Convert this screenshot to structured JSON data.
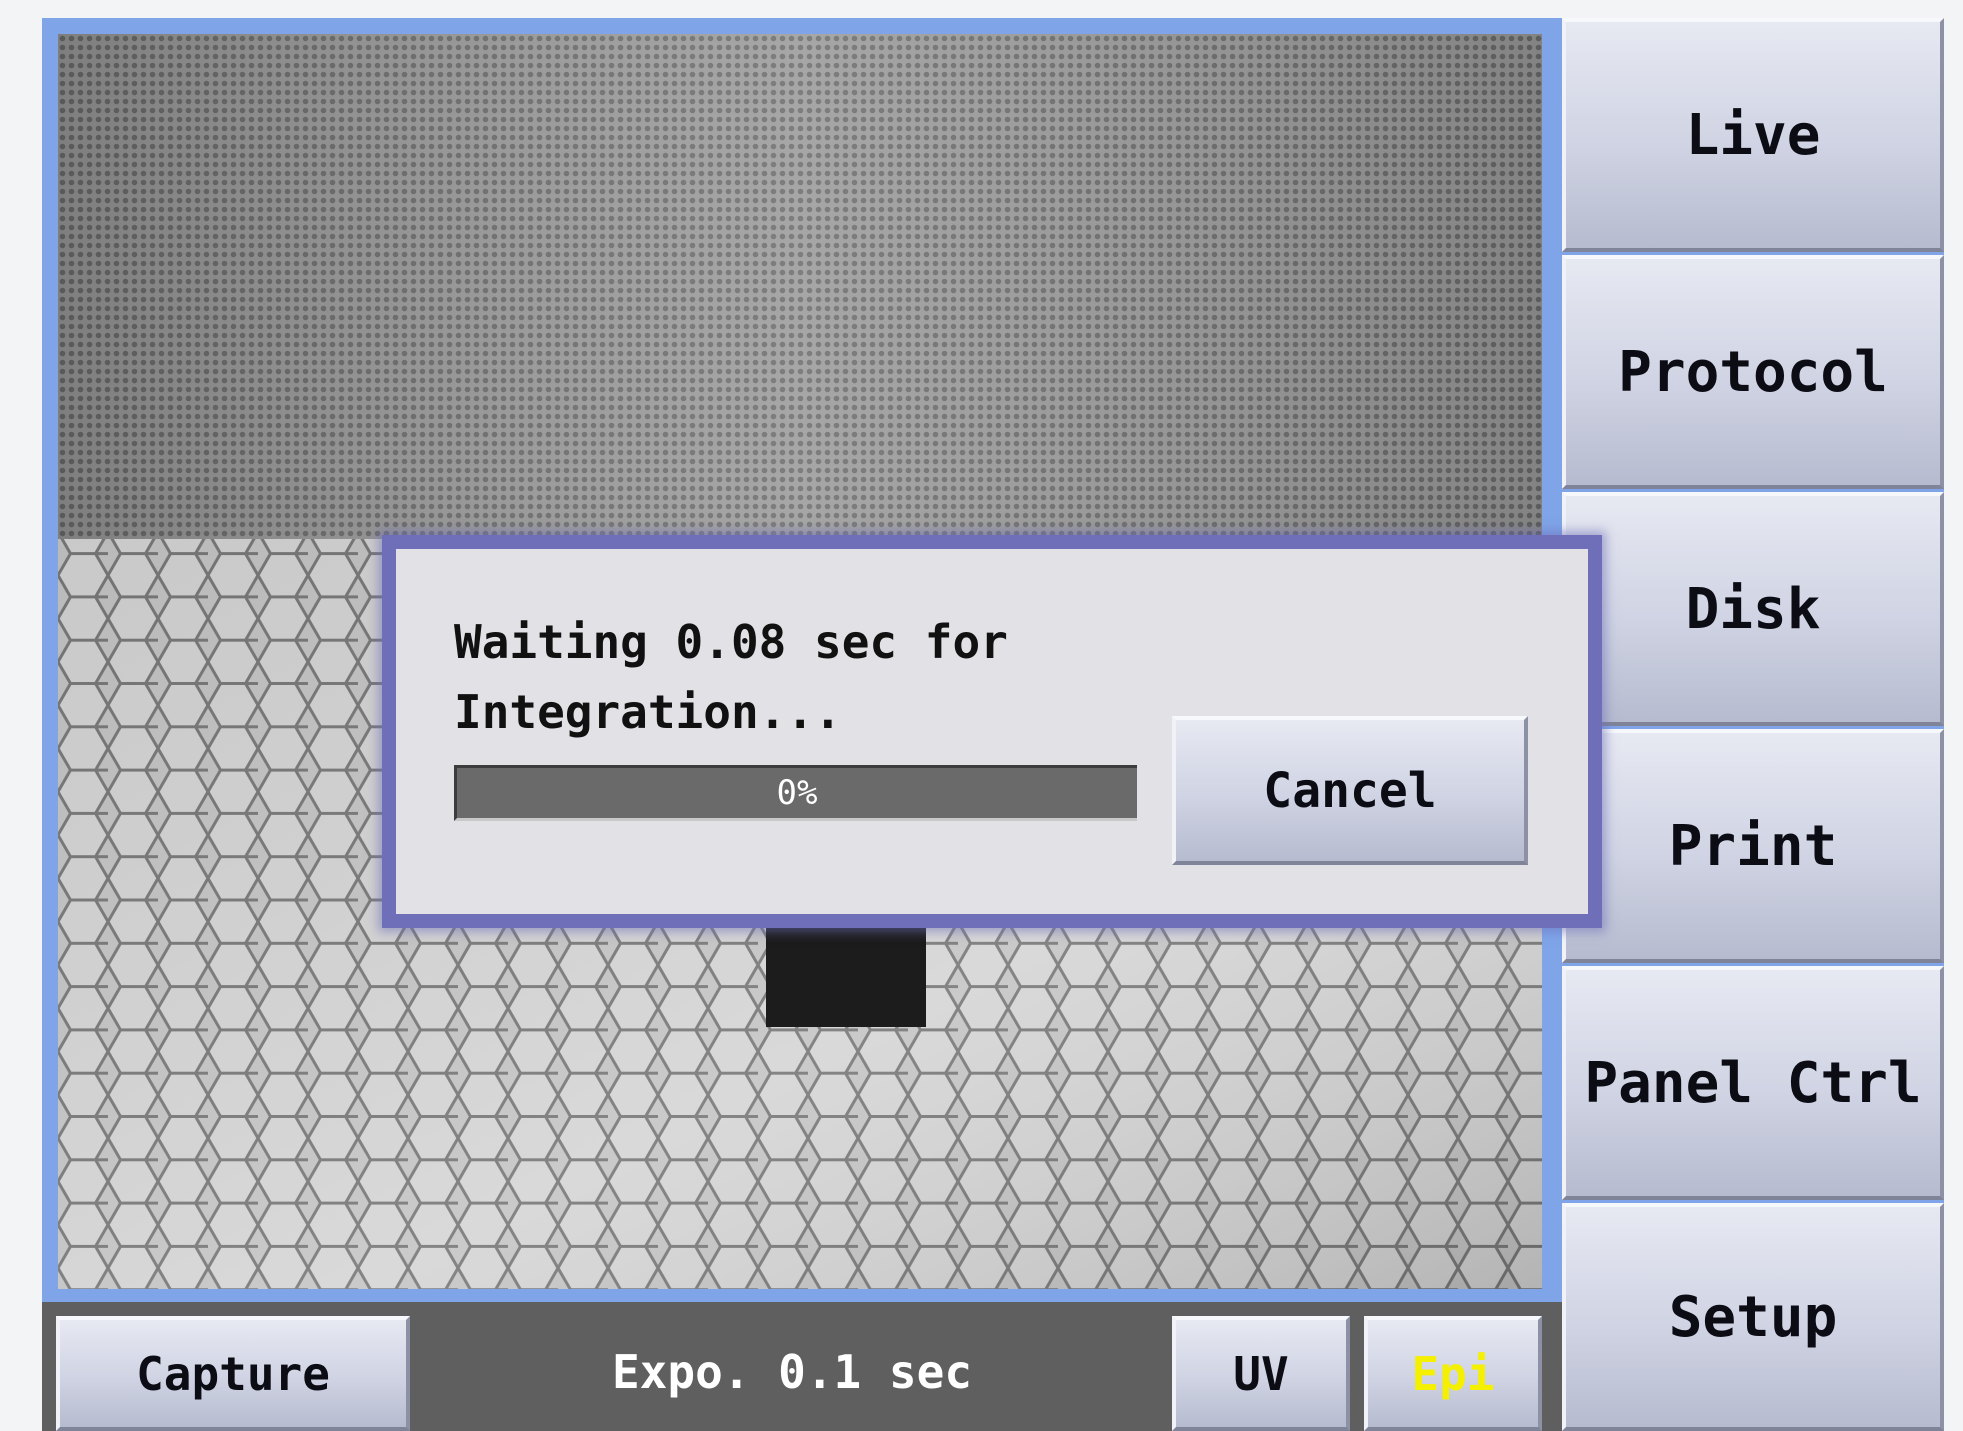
{
  "image_view": {
    "upper_pattern": "fine-mesh",
    "lower_pattern": "hexagon-grid"
  },
  "bottom_bar": {
    "capture_label": "Capture",
    "exposure_text": "Expo. 0.1 sec",
    "uv_label": "UV",
    "epi_label": "Epi",
    "epi_color": "#f4f000"
  },
  "side_menu": {
    "items": [
      {
        "label": "Live"
      },
      {
        "label": "Protocol"
      },
      {
        "label": "Disk"
      },
      {
        "label": "Print"
      },
      {
        "label": "Panel Ctrl"
      },
      {
        "label": "Setup"
      }
    ]
  },
  "dialog": {
    "message_line1": "Waiting 0.08 sec for",
    "message_line2": "Integration...",
    "progress_text": "0%",
    "progress_fraction": 0,
    "cancel_label": "Cancel"
  },
  "colors": {
    "frame": "#7fa4e8",
    "dialog_border": "#6e6fb8",
    "button_face": "#cfd3e3",
    "status_bar": "#5f5f5f"
  }
}
